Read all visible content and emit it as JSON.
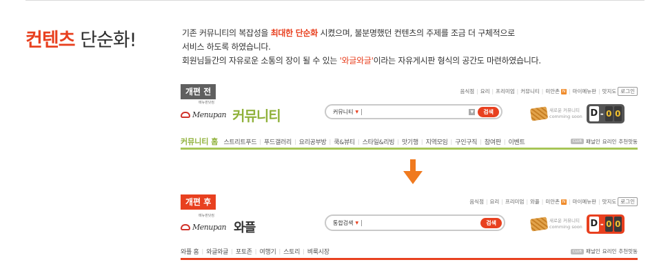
{
  "title": {
    "accent": "컨텐츠",
    "rest": " 단순화!"
  },
  "description": {
    "line1_a": "기존 커뮤니티의 복잡성을 ",
    "line1_hl": "최대한 단순화",
    "line1_b": " 시켰으며, 불분명했던 컨텐츠의 주제를 조금 더 구체적으로",
    "line2": "서비스 하도록 하였습니다.",
    "line3_a": "회원님들간의 자유로운 소통의 장이 될 수 있는 ",
    "line3_hl": "'와글와글'",
    "line3_b": "이라는 자유게시판 형식의 공간도 마련하였습니다."
  },
  "before": {
    "badge": "개편 전",
    "top_links": [
      "음식점",
      "요리",
      "프리미엄",
      "커뮤니티",
      "미안촌",
      "마이메뉴판",
      "맛지도"
    ],
    "top_links_badge": "N",
    "login": "로그인",
    "logo_small": "메뉴판닷컴",
    "logo_text": "Menupan",
    "service_name": "커뮤니티",
    "search_select": "커뮤니티",
    "search_dl": "▼",
    "search_button": "검색",
    "waffle_text1": "새로운 커뮤니티",
    "waffle_text2": "comming soon",
    "dday_d": "D",
    "dday_dash": "-",
    "dday_n1": "0",
    "dday_n2": "0",
    "nav_home": "커뮤니티 홈",
    "nav_items": [
      "스트리트푸드",
      "푸드갤러리",
      "요리공부방",
      "쿡&뷰티",
      "스타일&리빙",
      "맛기행",
      "지역모임",
      "구인구직",
      "참여판",
      "이벤트"
    ],
    "club": "CLUB",
    "right_links": [
      "패널인",
      "요리인",
      "추천맛동"
    ]
  },
  "after": {
    "badge": "개편 후",
    "top_links": [
      "음식점",
      "요리",
      "프리미엄",
      "와플",
      "미안촌",
      "마이메뉴판",
      "맛지도"
    ],
    "top_links_badge": "N",
    "login": "로그인",
    "logo_small": "메뉴판닷컴",
    "logo_text": "Menupan",
    "service_name": "와플",
    "search_select": "통합검색",
    "search_button": "검색",
    "waffle_text1": "새로운 커뮤니티",
    "waffle_text2": "comming soon",
    "dday_d": "D",
    "dday_dash": "-",
    "dday_n1": "0",
    "dday_n2": "0",
    "nav_items": [
      "와플 홈",
      "와글와글",
      "포토존",
      "여행기",
      "스토리",
      "벼룩시장"
    ],
    "club": "CLUB",
    "right_links": [
      "패널인",
      "요리인",
      "추천맛동"
    ]
  },
  "colors": {
    "accent": "#e8401f",
    "green": "#8fb13a",
    "gray_badge": "#5f5f5f"
  }
}
